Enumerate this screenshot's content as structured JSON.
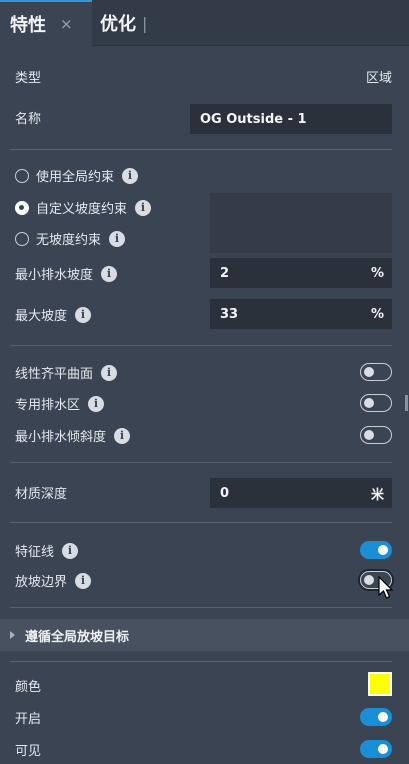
{
  "tabs": [
    {
      "label": "特性",
      "close": "×"
    },
    {
      "label": "优化",
      "sep": "|"
    }
  ],
  "type_row": {
    "label": "类型",
    "value": "区域"
  },
  "name_row": {
    "label": "名称",
    "value": "OG Outside - 1"
  },
  "radios": [
    {
      "label": "使用全局约束",
      "selected": false
    },
    {
      "label": "自定义坡度约束",
      "selected": true
    },
    {
      "label": "无坡度约束",
      "selected": false
    }
  ],
  "min_slope": {
    "label": "最小排水坡度",
    "value": "2",
    "unit": "%"
  },
  "max_slope": {
    "label": "最大坡度",
    "value": "33",
    "unit": "%"
  },
  "toggles_group1": [
    {
      "label": "线性齐平曲面",
      "on": false
    },
    {
      "label": "专用排水区",
      "on": false
    },
    {
      "label": "最小排水倾斜度",
      "on": false
    }
  ],
  "material_depth": {
    "label": "材质深度",
    "value": "0",
    "unit": "米"
  },
  "toggles_group2": [
    {
      "label": "特征线",
      "on": true
    },
    {
      "label": "放坡边界",
      "on": false
    }
  ],
  "section": {
    "title": "遵循全局放坡目标"
  },
  "color_row": {
    "label": "颜色",
    "color": "#ffff00"
  },
  "enabled_row": {
    "label": "开启",
    "on": true
  },
  "visible_row": {
    "label": "可见",
    "on": true
  },
  "info_glyph": "i",
  "icons": {
    "info": "info-icon",
    "close": "close-icon",
    "caret": "caret-right-icon",
    "cursor": "mouse-cursor"
  }
}
